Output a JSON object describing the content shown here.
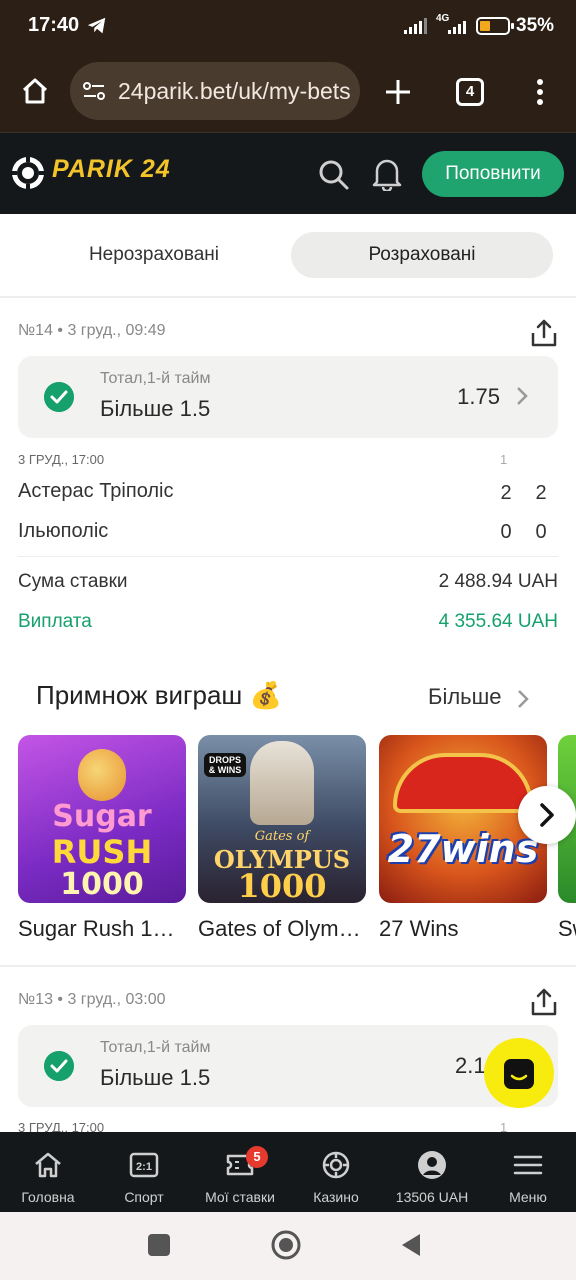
{
  "status_bar": {
    "time": "17:40",
    "network": "4G",
    "battery": "35%"
  },
  "browser": {
    "url": "24parik.bet/uk/my-bets",
    "tab_count": "4"
  },
  "site": {
    "logo": "PARIK 24",
    "topup_label": "Поповнити"
  },
  "tabs": [
    {
      "label": "Нерозраховані",
      "active": false
    },
    {
      "label": "Розраховані",
      "active": true
    }
  ],
  "bets": [
    {
      "header": "№14 • 3 груд., 09:49",
      "market": "Тотал,1-й тайм",
      "selection": "Більше 1.5",
      "odds": "1.75",
      "event_time": "3 ГРУД., 17:00",
      "period_label": "1",
      "teams": [
        {
          "name": "Астерас Тріполіс",
          "score_period": "2",
          "score_total": "2"
        },
        {
          "name": "Ільюполіс",
          "score_period": "0",
          "score_total": "0"
        }
      ],
      "stake_label": "Сума ставки",
      "stake_value": "2 488.94 UAH",
      "payout_label": "Виплата",
      "payout_value": "4 355.64 UAH"
    },
    {
      "header": "№13 • 3 груд., 03:00",
      "market": "Тотал,1-й тайм",
      "selection": "Більше 1.5",
      "odds": "2.1",
      "event_time": "3 ГРУД., 17:00",
      "period_label": "1"
    }
  ],
  "games_section": {
    "title": "Примнож виграш",
    "emoji": "💰",
    "more_label": "Більше",
    "games": [
      {
        "name": "Sugar Rush 1000",
        "art_line1": "Sugar",
        "art_line2": "RUSH",
        "art_line3": "1000"
      },
      {
        "name": "Gates of Olympus 1000",
        "art_badge": "DROPS & WINS",
        "art_line1": "Gates of",
        "art_line2": "OLYMPUS",
        "art_line3": "1000"
      },
      {
        "name": "27 Wins",
        "art_line1": "27wins"
      },
      {
        "name": "Sw"
      }
    ]
  },
  "bottom_nav": [
    {
      "label": "Головна",
      "icon": "home-icon"
    },
    {
      "label": "Спорт",
      "icon": "scoreboard-icon",
      "icon_text": "2:1"
    },
    {
      "label": "Мої ставки",
      "icon": "ticket-icon",
      "badge": "5"
    },
    {
      "label": "Казино",
      "icon": "casino-chip-icon"
    },
    {
      "label": "13506 UAH",
      "icon": "profile-icon"
    },
    {
      "label": "Меню",
      "icon": "menu-icon"
    }
  ],
  "colors": {
    "accent_green": "#1fa36f",
    "logo_yellow": "#f3c42a",
    "header_bg": "#15181b",
    "support_yellow": "#f8ec0e",
    "badge_red": "#e63a2e"
  }
}
